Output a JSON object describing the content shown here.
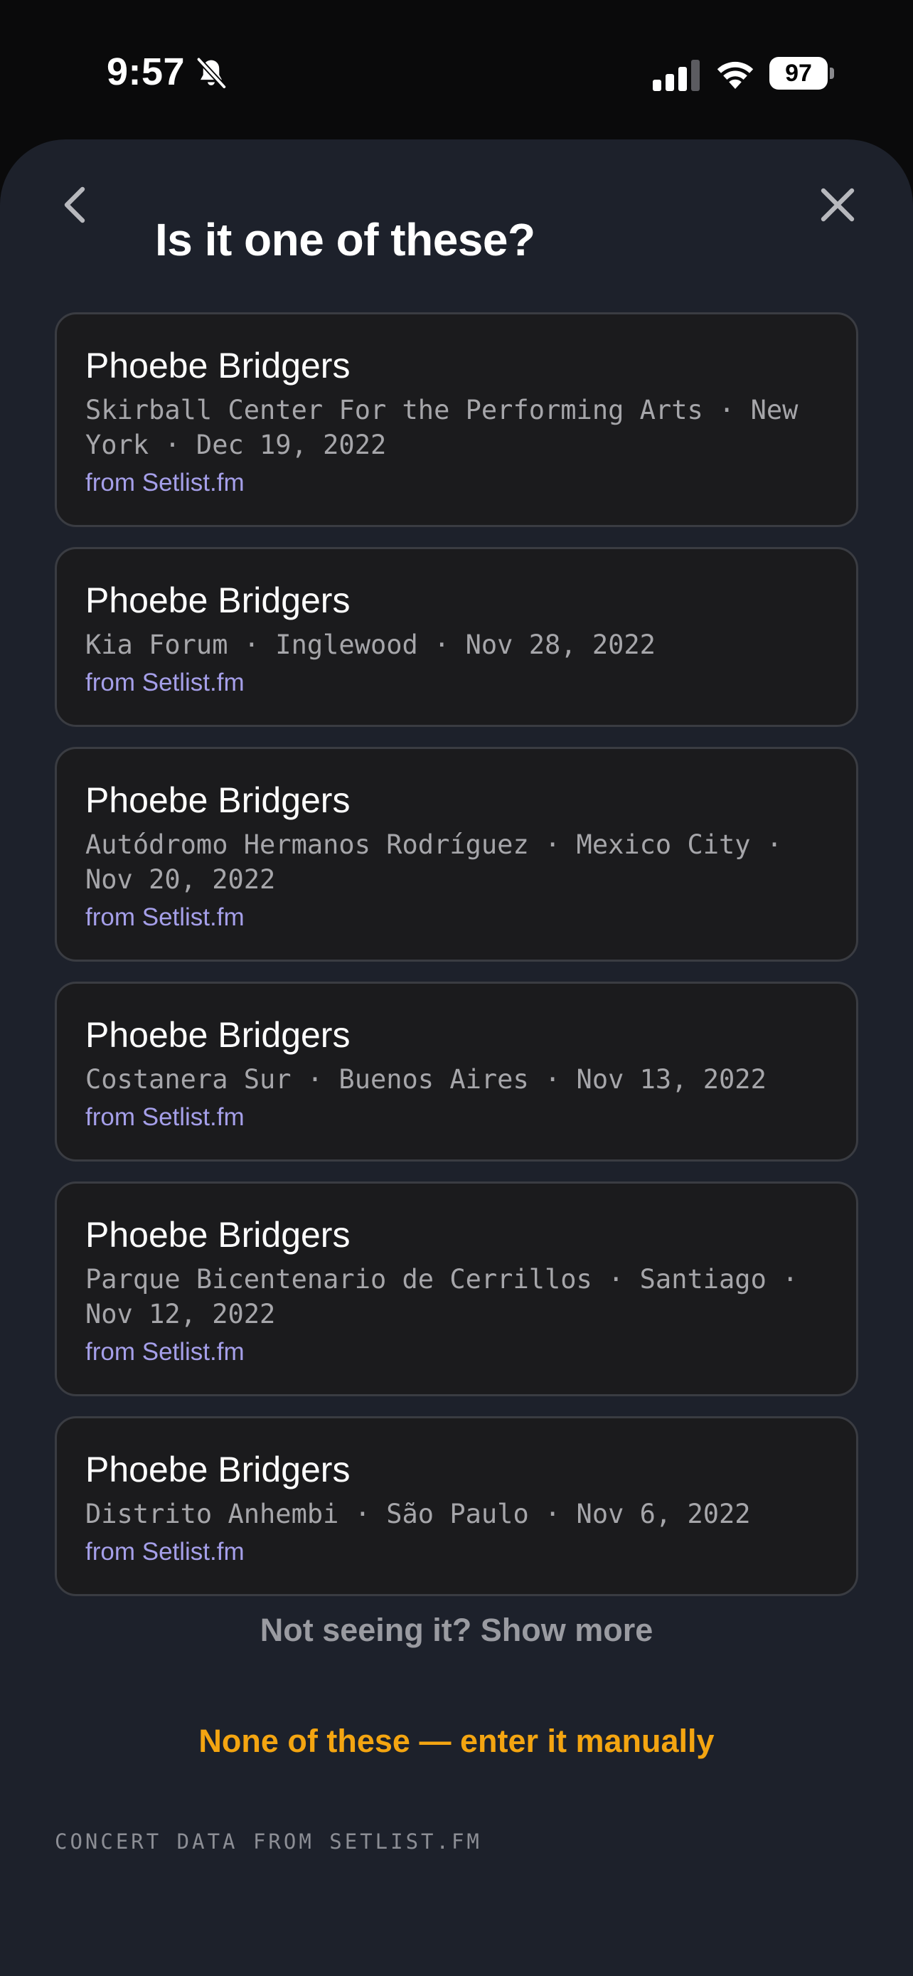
{
  "status_bar": {
    "time": "9:57",
    "battery": "97",
    "icons": [
      "bell-slash-icon",
      "cellular-signal-icon",
      "wifi-icon",
      "battery-icon"
    ]
  },
  "header": {
    "title": "Is it one of these?",
    "icons": [
      "chevron-left-icon",
      "close-icon"
    ]
  },
  "results": [
    {
      "artist": "Phoebe Bridgers",
      "details": "Skirball Center For the Performing Arts · New York · Dec 19, 2022",
      "source": "from Setlist.fm"
    },
    {
      "artist": "Phoebe Bridgers",
      "details": "Kia Forum · Inglewood · Nov 28, 2022",
      "source": "from Setlist.fm"
    },
    {
      "artist": "Phoebe Bridgers",
      "details": "Autódromo Hermanos Rodríguez · Mexico City · Nov 20, 2022",
      "source": "from Setlist.fm"
    },
    {
      "artist": "Phoebe Bridgers",
      "details": "Costanera Sur · Buenos Aires · Nov 13, 2022",
      "source": "from Setlist.fm"
    },
    {
      "artist": "Phoebe Bridgers",
      "details": "Parque Bicentenario de Cerrillos · Santiago · Nov 12, 2022",
      "source": "from Setlist.fm"
    },
    {
      "artist": "Phoebe Bridgers",
      "details": "Distrito Anhembi · São Paulo · Nov 6, 2022",
      "source": "from Setlist.fm"
    }
  ],
  "actions": {
    "show_more": "Not seeing it? Show more",
    "manual_entry": "None of these — enter it manually"
  },
  "footer": {
    "attribution": "CONCERT DATA FROM SETLIST.FM"
  },
  "colors": {
    "sheet_background": "#1d212b",
    "card_background": "#1b1b1d",
    "card_border": "#3a3c42",
    "source_link": "#a59fe9",
    "accent": "#f4a511",
    "muted_text": "#9a9ba1"
  }
}
